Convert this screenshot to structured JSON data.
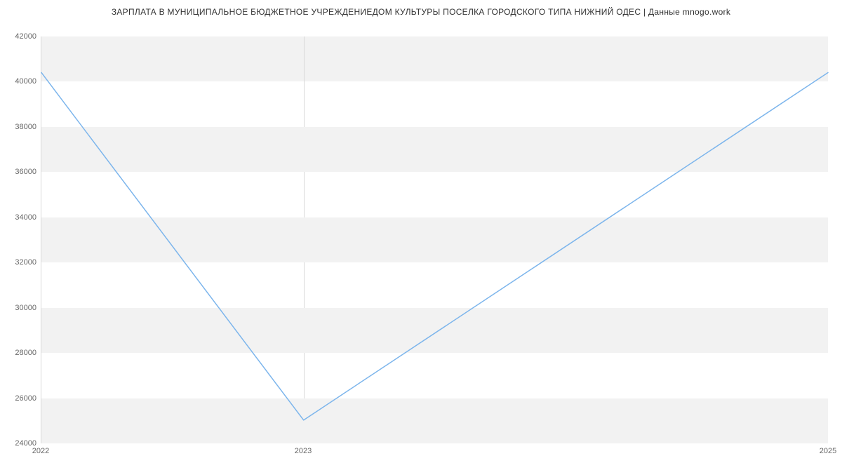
{
  "chart_data": {
    "type": "line",
    "title": "ЗАРПЛАТА В МУНИЦИПАЛЬНОЕ БЮДЖЕТНОЕ УЧРЕЖДЕНИЕДОМ КУЛЬТУРЫ ПОСЕЛКА ГОРОДСКОГО ТИПА НИЖНИЙ ОДЕС | Данные mnogo.work",
    "x": [
      2022,
      2023,
      2025
    ],
    "values": [
      40400,
      25000,
      40400
    ],
    "x_ticks": [
      2022,
      2023,
      2025
    ],
    "y_ticks": [
      24000,
      26000,
      28000,
      30000,
      32000,
      34000,
      36000,
      38000,
      40000,
      42000
    ],
    "ylim": [
      24000,
      42000
    ],
    "xlim": [
      2022,
      2025
    ],
    "xlabel": "",
    "ylabel": "",
    "band_pairs": [
      [
        24000,
        26000
      ],
      [
        28000,
        30000
      ],
      [
        32000,
        34000
      ],
      [
        36000,
        38000
      ],
      [
        40000,
        42000
      ]
    ],
    "line_color": "#7cb5ec"
  }
}
